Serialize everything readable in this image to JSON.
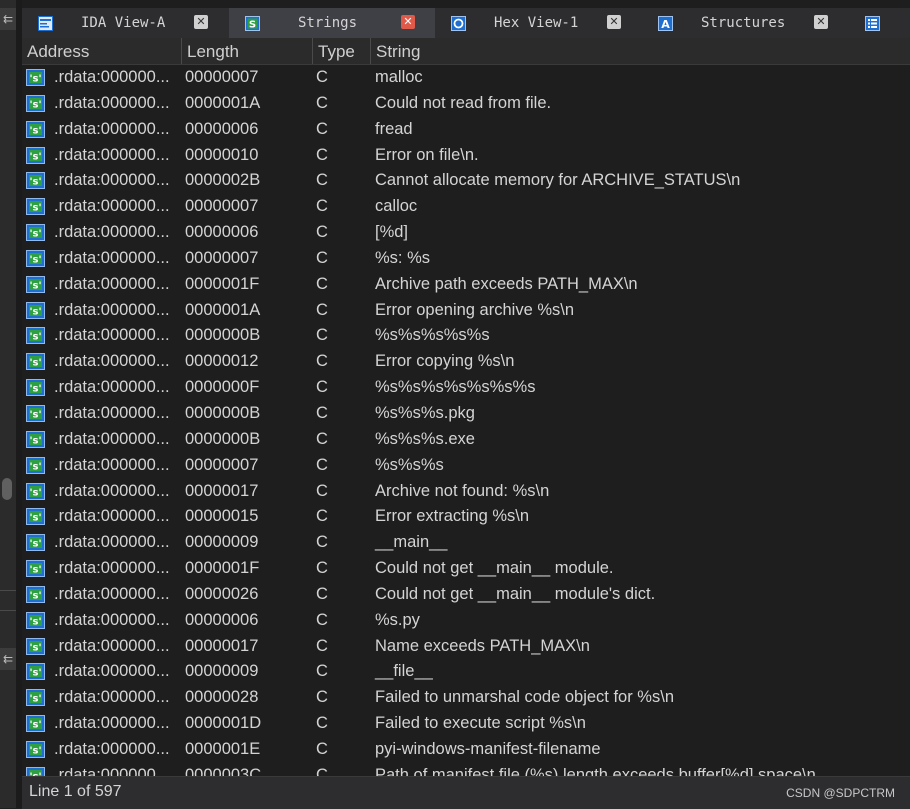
{
  "tabs": [
    {
      "label": "IDA View-A",
      "icon": "ida-view-icon",
      "active": false
    },
    {
      "label": "Strings",
      "icon": "strings-icon",
      "active": true
    },
    {
      "label": "Hex View-1",
      "icon": "hex-view-icon",
      "active": false
    },
    {
      "label": "Structures",
      "icon": "structures-icon",
      "active": false
    },
    {
      "label": "",
      "icon": "enums-icon",
      "active": false
    }
  ],
  "tab_close_glyph": "✕",
  "left_strip": {
    "top_button": "⇇",
    "bottom_button": "⇇"
  },
  "columns": {
    "address": "Address",
    "length": "Length",
    "type": "Type",
    "string": "String"
  },
  "rows": [
    {
      "address": ".rdata:000000...",
      "length": "00000007",
      "type": "C",
      "string": "malloc"
    },
    {
      "address": ".rdata:000000...",
      "length": "0000001A",
      "type": "C",
      "string": "Could not read from file."
    },
    {
      "address": ".rdata:000000...",
      "length": "00000006",
      "type": "C",
      "string": "fread"
    },
    {
      "address": ".rdata:000000...",
      "length": "00000010",
      "type": "C",
      "string": "Error on file\\n."
    },
    {
      "address": ".rdata:000000...",
      "length": "0000002B",
      "type": "C",
      "string": "Cannot allocate memory for ARCHIVE_STATUS\\n"
    },
    {
      "address": ".rdata:000000...",
      "length": "00000007",
      "type": "C",
      "string": "calloc"
    },
    {
      "address": ".rdata:000000...",
      "length": "00000006",
      "type": "C",
      "string": "[%d]"
    },
    {
      "address": ".rdata:000000...",
      "length": "00000007",
      "type": "C",
      "string": "%s: %s"
    },
    {
      "address": ".rdata:000000...",
      "length": "0000001F",
      "type": "C",
      "string": "Archive path exceeds PATH_MAX\\n"
    },
    {
      "address": ".rdata:000000...",
      "length": "0000001A",
      "type": "C",
      "string": "Error opening archive %s\\n"
    },
    {
      "address": ".rdata:000000...",
      "length": "0000000B",
      "type": "C",
      "string": "%s%s%s%s%s"
    },
    {
      "address": ".rdata:000000...",
      "length": "00000012",
      "type": "C",
      "string": "Error copying %s\\n"
    },
    {
      "address": ".rdata:000000...",
      "length": "0000000F",
      "type": "C",
      "string": "%s%s%s%s%s%s%s"
    },
    {
      "address": ".rdata:000000...",
      "length": "0000000B",
      "type": "C",
      "string": "%s%s%s.pkg"
    },
    {
      "address": ".rdata:000000...",
      "length": "0000000B",
      "type": "C",
      "string": "%s%s%s.exe"
    },
    {
      "address": ".rdata:000000...",
      "length": "00000007",
      "type": "C",
      "string": "%s%s%s"
    },
    {
      "address": ".rdata:000000...",
      "length": "00000017",
      "type": "C",
      "string": "Archive not found: %s\\n"
    },
    {
      "address": ".rdata:000000...",
      "length": "00000015",
      "type": "C",
      "string": "Error extracting %s\\n"
    },
    {
      "address": ".rdata:000000...",
      "length": "00000009",
      "type": "C",
      "string": "__main__"
    },
    {
      "address": ".rdata:000000...",
      "length": "0000001F",
      "type": "C",
      "string": "Could not get __main__ module."
    },
    {
      "address": ".rdata:000000...",
      "length": "00000026",
      "type": "C",
      "string": "Could not get __main__ module's dict."
    },
    {
      "address": ".rdata:000000...",
      "length": "00000006",
      "type": "C",
      "string": "%s.py"
    },
    {
      "address": ".rdata:000000...",
      "length": "00000017",
      "type": "C",
      "string": "Name exceeds PATH_MAX\\n"
    },
    {
      "address": ".rdata:000000...",
      "length": "00000009",
      "type": "C",
      "string": "__file__"
    },
    {
      "address": ".rdata:000000...",
      "length": "00000028",
      "type": "C",
      "string": "Failed to unmarshal code object for %s\\n"
    },
    {
      "address": ".rdata:000000...",
      "length": "0000001D",
      "type": "C",
      "string": "Failed to execute script %s\\n"
    },
    {
      "address": ".rdata:000000...",
      "length": "0000001E",
      "type": "C",
      "string": "pyi-windows-manifest-filename"
    },
    {
      "address": ".rdata:000000...",
      "length": "0000003C",
      "type": "C",
      "string": "Path of manifest file (%s) length exceeds buffer[%d] space\\n"
    }
  ],
  "status": {
    "text": "Line 1 of 597"
  },
  "watermark": "CSDN @SDPCTRM",
  "colors": {
    "accent_blue": "#1f6fd1",
    "icon_green": "#2ea043",
    "close_active": "#e05a4a"
  }
}
